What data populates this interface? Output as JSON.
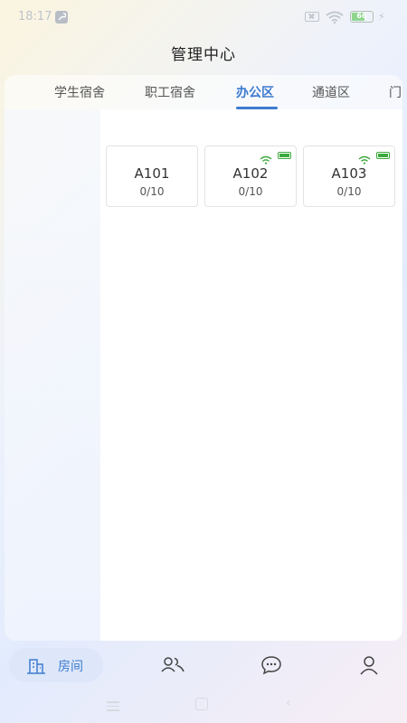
{
  "status_bar": {
    "time": "18:17",
    "battery_level": "66",
    "icons": [
      "wrench-icon",
      "sim-off-icon",
      "wifi-icon",
      "battery-icon",
      "charging-icon"
    ]
  },
  "header": {
    "title": "管理中心"
  },
  "tabs": [
    {
      "label": "学生宿舍",
      "active": false
    },
    {
      "label": "职工宿舍",
      "active": false
    },
    {
      "label": "办公区",
      "active": true
    },
    {
      "label": "通道区",
      "active": false
    },
    {
      "label": "门",
      "active": false
    }
  ],
  "rooms": [
    {
      "name": "A101",
      "occupancy": "0/10",
      "online": false
    },
    {
      "name": "A102",
      "occupancy": "0/10",
      "online": true
    },
    {
      "name": "A103",
      "occupancy": "0/10",
      "online": true
    }
  ],
  "bottom_nav": [
    {
      "label": "房间",
      "icon": "building-icon",
      "active": true
    },
    {
      "label": "",
      "icon": "users-icon",
      "active": false
    },
    {
      "label": "",
      "icon": "chat-icon",
      "active": false
    },
    {
      "label": "",
      "icon": "user-icon",
      "active": false
    }
  ],
  "colors": {
    "accent": "#3e7bd0",
    "online_green": "#3daa3d",
    "card_border": "#e3e3e3"
  }
}
